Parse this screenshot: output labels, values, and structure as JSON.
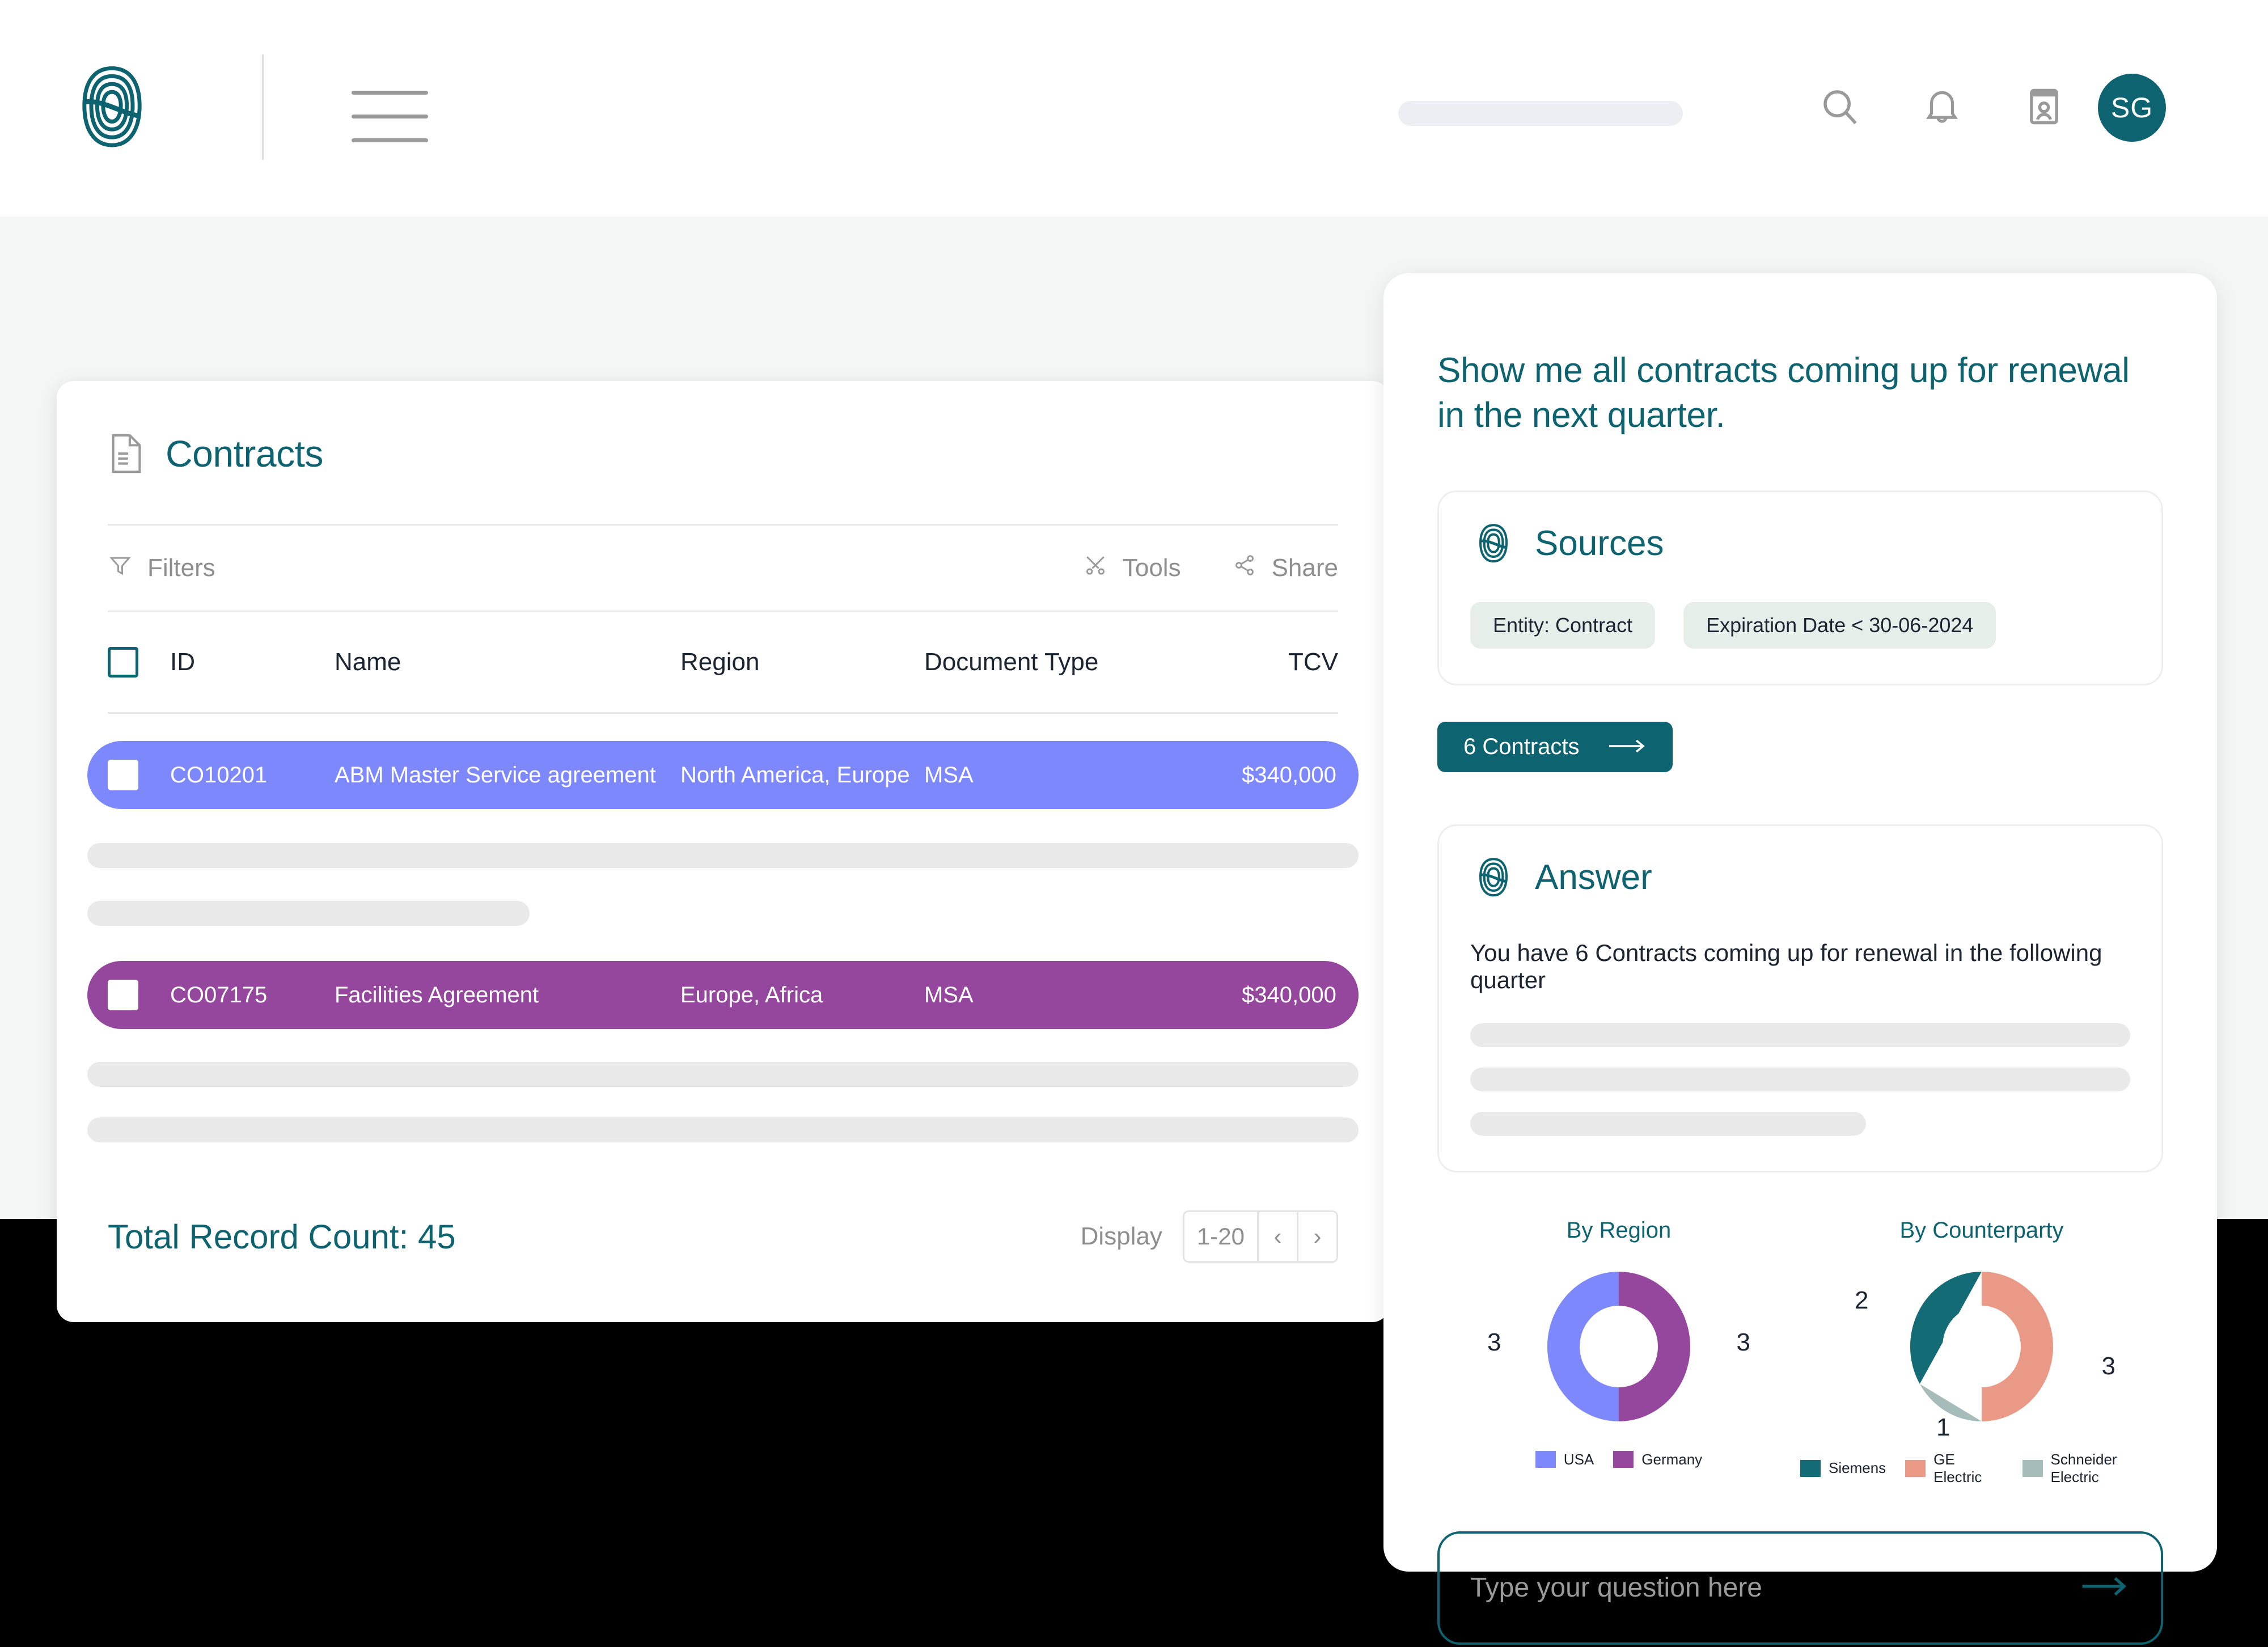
{
  "brand": {
    "teal": "#0d6370",
    "logo_icon": "infinity-s-logo",
    "name": "sirion-logo"
  },
  "topbar": {
    "menu_icon": "hamburger-menu-icon",
    "search_pill_placeholder": "",
    "icons": [
      {
        "name": "search-icon"
      },
      {
        "name": "bell-icon"
      },
      {
        "name": "id-card-icon"
      }
    ],
    "avatar_initials": "SG"
  },
  "contracts": {
    "icon": "document-icon",
    "title": "Contracts",
    "toolbar": {
      "filters_label": "Filters",
      "filters_icon": "funnel-icon",
      "tools_label": "Tools",
      "tools_icon": "wrench-screwdriver-icon",
      "share_label": "Share",
      "share_icon": "share-nodes-icon"
    },
    "columns": [
      "ID",
      "Name",
      "Region",
      "Document Type",
      "TCV"
    ],
    "rows": [
      {
        "id": "CO10201",
        "name": "ABM Master Service agreement",
        "region": "North America, Europe",
        "doc_type": "MSA",
        "tcv": "$340,000",
        "highlight": "#7d88fc"
      },
      {
        "id": "CO07175",
        "name": "Facilities Agreement",
        "region": "Europe, Africa",
        "doc_type": "MSA",
        "tcv": "$340,000",
        "highlight": "#94479c"
      }
    ],
    "total_record_label": "Total Record Count: 45",
    "pager": {
      "display_label": "Display",
      "range": "1-20",
      "prev_icon": "chevron-left-icon",
      "next_icon": "chevron-right-icon"
    }
  },
  "assistant": {
    "question": "Show me all contracts coming up for renewal in the next quarter.",
    "sources": {
      "icon": "sirion-logo-icon",
      "title": "Sources",
      "chips": [
        "Entity: Contract",
        "Expiration Date < 30-06-2024"
      ]
    },
    "cta": {
      "label": "6 Contracts",
      "icon": "arrow-right-icon"
    },
    "answer": {
      "icon": "sirion-logo-icon",
      "title": "Answer",
      "text": "You have 6 Contracts coming up for renewal in the following quarter"
    },
    "ask": {
      "placeholder": "Type your question here",
      "submit_icon": "arrow-right-icon"
    }
  },
  "chart_data": [
    {
      "type": "pie",
      "title": "By Region",
      "categories": [
        "USA",
        "Germany"
      ],
      "values": [
        3,
        3
      ],
      "colors": [
        "#7d88fc",
        "#94479c"
      ],
      "labels": [
        "3",
        "3"
      ],
      "legend_position": "bottom",
      "donut": true
    },
    {
      "type": "pie",
      "title": "By Counterparty",
      "categories": [
        "Siemens",
        "GE Electric",
        "Schneider Electric"
      ],
      "values": [
        2,
        3,
        1
      ],
      "colors": [
        "#136b75",
        "#e99985",
        "#a6bcbb"
      ],
      "labels": [
        "2",
        "3",
        "1"
      ],
      "legend_position": "bottom",
      "donut": true
    }
  ]
}
